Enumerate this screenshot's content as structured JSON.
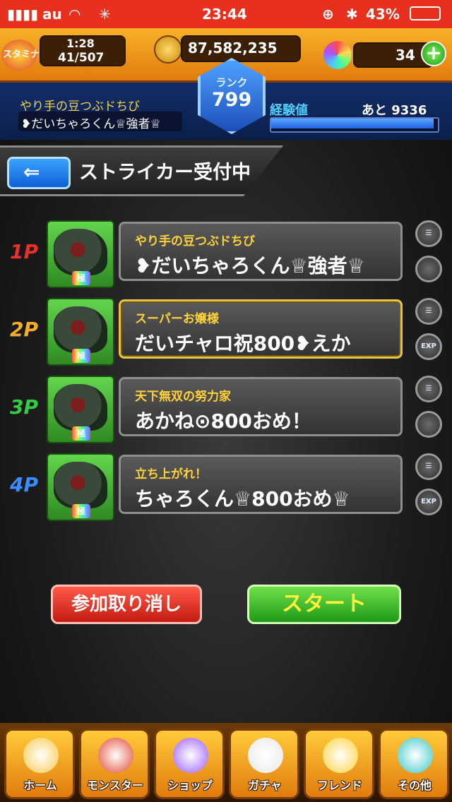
{
  "status_bar": {
    "carrier": "au",
    "time": "23:44",
    "battery": "43%"
  },
  "hud": {
    "stamina_label": "スタミナ",
    "stamina_timer": "1:28",
    "stamina_value": "41/507",
    "coins": "87,582,235",
    "orbs": "34",
    "rank_label": "ランク",
    "rank_value": "799",
    "player_title": "やり手の豆つぶドちび",
    "player_name": "❥だいちゃろくん♕強者♕",
    "exp_label": "経験値",
    "exp_remaining": "あと 9336",
    "exp_fill_fraction": 0.99
  },
  "header": {
    "title": "ストライカー受付中"
  },
  "players": [
    {
      "slot": "1P",
      "slot_color": "#e8302a",
      "title": "やり手の豆つぶドちび",
      "name": "❥だいちゃろくん♕強者♕",
      "highlighted": false
    },
    {
      "slot": "2P",
      "slot_color": "#f2b02a",
      "title": "スーパーお嬢様",
      "name": "だいチャロ祝800❥えか",
      "highlighted": true,
      "side_badge": "EXP"
    },
    {
      "slot": "3P",
      "slot_color": "#33cc44",
      "title": "天下無双の努力家",
      "name": "あかね⊙800おめ！",
      "highlighted": false
    },
    {
      "slot": "4P",
      "slot_color": "#3a8cff",
      "title": "立ち上がれ！",
      "name": "ちゃろくん♕800おめ♕",
      "highlighted": false,
      "side_badge": "EXP"
    }
  ],
  "monster_badge": "極",
  "actions": {
    "cancel": "参加取り消し",
    "start": "スタート"
  },
  "bottom_nav": [
    {
      "label": "ホーム",
      "icon": "home-icon",
      "color": "#f7c948"
    },
    {
      "label": "モンスター",
      "icon": "monster-icon",
      "color": "#e2472e"
    },
    {
      "label": "ショップ",
      "icon": "orb-icon",
      "color": "#9b59ff"
    },
    {
      "label": "ガチャ",
      "icon": "egg-icon",
      "color": "#e8e8e8"
    },
    {
      "label": "フレンド",
      "icon": "friends-icon",
      "color": "#ffd23a"
    },
    {
      "label": "その他",
      "icon": "other-icon",
      "color": "#3ac7c7"
    }
  ]
}
